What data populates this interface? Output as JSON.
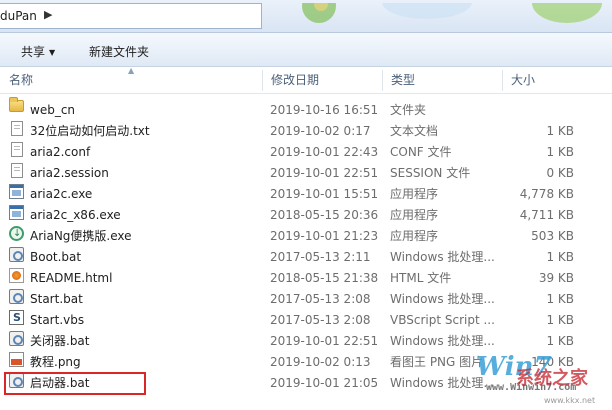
{
  "address_bar": {
    "path": "duPan"
  },
  "toolbar": {
    "share_label": "共享",
    "new_folder_label": "新建文件夹"
  },
  "columns": {
    "name": "名称",
    "date": "修改日期",
    "type": "类型",
    "size": "大小"
  },
  "files": [
    {
      "name": "web_cn",
      "date": "2019-10-16 16:51",
      "type": "文件夹",
      "size": "",
      "icon": "folder-icon"
    },
    {
      "name": "32位启动如何启动.txt",
      "date": "2019-10-02 0:17",
      "type": "文本文档",
      "size": "1 KB",
      "icon": "text-file-icon"
    },
    {
      "name": "aria2.conf",
      "date": "2019-10-01 22:43",
      "type": "CONF 文件",
      "size": "1 KB",
      "icon": "blank-file-icon"
    },
    {
      "name": "aria2.session",
      "date": "2019-10-01 22:51",
      "type": "SESSION 文件",
      "size": "0 KB",
      "icon": "blank-file-icon"
    },
    {
      "name": "aria2c.exe",
      "date": "2019-10-01 15:51",
      "type": "应用程序",
      "size": "4,778 KB",
      "icon": "exe-icon"
    },
    {
      "name": "aria2c_x86.exe",
      "date": "2018-05-15 20:36",
      "type": "应用程序",
      "size": "4,711 KB",
      "icon": "exe-icon"
    },
    {
      "name": "AriaNg便携版.exe",
      "date": "2019-10-01 21:23",
      "type": "应用程序",
      "size": "503 KB",
      "icon": "ariang-icon"
    },
    {
      "name": "Boot.bat",
      "date": "2017-05-13 2:11",
      "type": "Windows 批处理...",
      "size": "1 KB",
      "icon": "batch-file-icon"
    },
    {
      "name": "README.html",
      "date": "2018-05-15 21:38",
      "type": "HTML 文件",
      "size": "39 KB",
      "icon": "html-file-icon"
    },
    {
      "name": "Start.bat",
      "date": "2017-05-13 2:08",
      "type": "Windows 批处理...",
      "size": "1 KB",
      "icon": "batch-file-icon"
    },
    {
      "name": "Start.vbs",
      "date": "2017-05-13 2:08",
      "type": "VBScript Script ...",
      "size": "1 KB",
      "icon": "vbscript-file-icon"
    },
    {
      "name": "关闭器.bat",
      "date": "2019-10-01 22:51",
      "type": "Windows 批处理...",
      "size": "1 KB",
      "icon": "batch-file-icon"
    },
    {
      "name": "教程.png",
      "date": "2019-10-02 0:13",
      "type": "看图王 PNG 图片",
      "size": "140 KB",
      "icon": "png-file-icon"
    },
    {
      "name": "启动器.bat",
      "date": "2019-10-01 21:05",
      "type": "Windows 批处理...",
      "size": "",
      "icon": "batch-file-icon"
    }
  ],
  "watermark": {
    "logo": "Win7",
    "name": "系统之家",
    "url": "www.Winwin7.com",
    "url2": "www.kkx.net"
  }
}
